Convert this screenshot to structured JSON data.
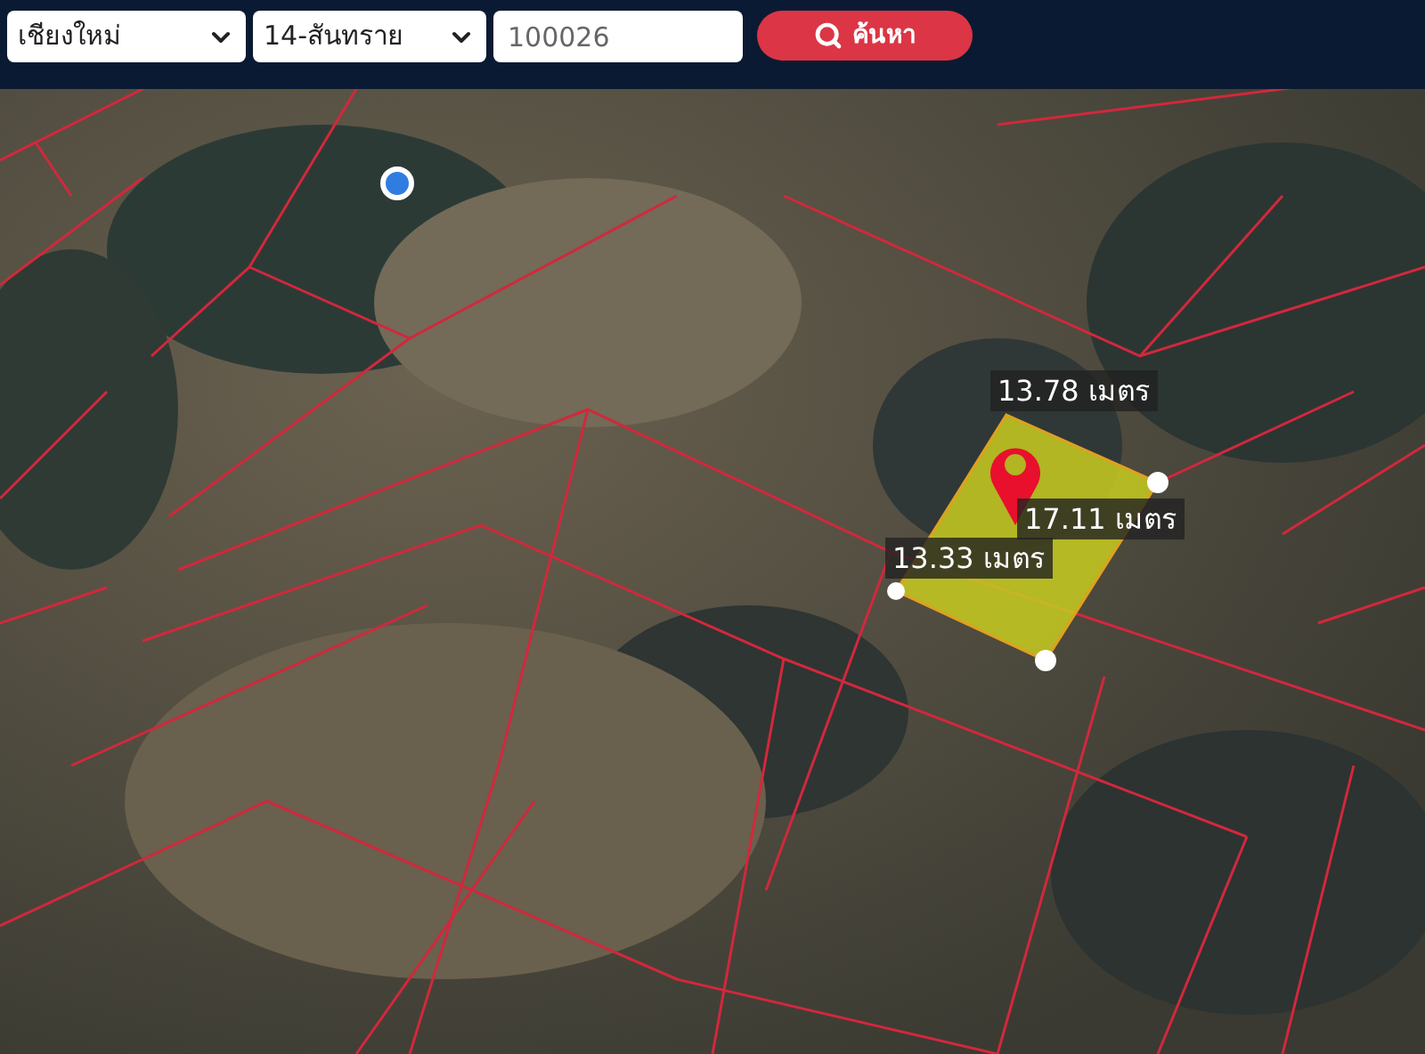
{
  "search_bar": {
    "province": {
      "value": "เชียงใหม่"
    },
    "district": {
      "value": "14-สันทราย"
    },
    "parcel_field": {
      "placeholder": "100026"
    },
    "search_button": {
      "label": "ค้นหา"
    }
  },
  "map": {
    "measurements": [
      {
        "label": "13.78 เมตร"
      },
      {
        "label": "17.11 เมตร"
      },
      {
        "label": "13.33 เมตร"
      }
    ]
  }
}
